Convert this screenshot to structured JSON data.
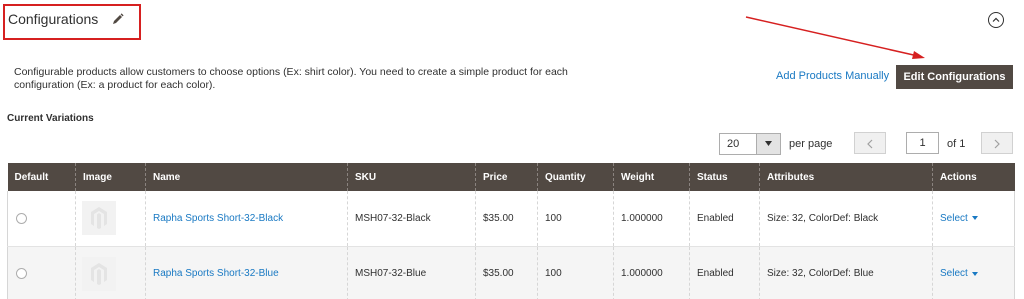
{
  "section": {
    "title": "Configurations",
    "description": "Configurable products allow customers to choose options (Ex: shirt color). You need to create a simple product for each configuration (Ex: a product for each color).",
    "add_manual_label": "Add Products Manually",
    "edit_config_label": "Edit Configurations",
    "current_variations_label": "Current Variations"
  },
  "pager": {
    "per_page_value": "20",
    "per_page_label": "per page",
    "current_page": "1",
    "of_label": "of 1"
  },
  "grid": {
    "columns": [
      "Default",
      "Image",
      "Name",
      "SKU",
      "Price",
      "Quantity",
      "Weight",
      "Status",
      "Attributes",
      "Actions"
    ],
    "rows": [
      {
        "name": "Rapha Sports Short-32-Black",
        "sku": "MSH07-32-Black",
        "price": "$35.00",
        "quantity": "100",
        "weight": "1.000000",
        "status": "Enabled",
        "attributes": "Size: 32, ColorDef: Black",
        "action": "Select"
      },
      {
        "name": "Rapha Sports Short-32-Blue",
        "sku": "MSH07-32-Blue",
        "price": "$35.00",
        "quantity": "100",
        "weight": "1.000000",
        "status": "Enabled",
        "attributes": "Size: 32, ColorDef: Blue",
        "action": "Select"
      }
    ]
  },
  "colors": {
    "header_bg": "#514943",
    "link": "#1979c3",
    "annotation_red": "#d62020"
  }
}
